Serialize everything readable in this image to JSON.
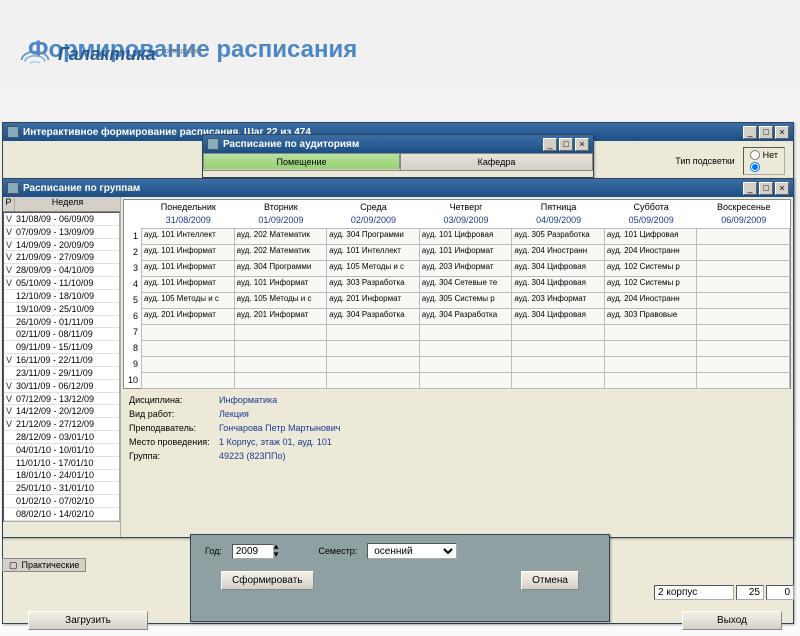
{
  "brand": {
    "name": "Галактика",
    "tag": "корпорация"
  },
  "page_title": "Формирование расписания",
  "win_main": {
    "title": "Интерактивное формирование расписания. Шаг 22 из 474",
    "highlight_label": "Тип подсветки",
    "radio_no": "Нет"
  },
  "win_rooms": {
    "title": "Расписание по аудиториям",
    "tabs": [
      "Помещение",
      "Кафедра"
    ]
  },
  "win_groups": {
    "title": "Расписание по группам",
    "week_label": "Неделя",
    "row_hdr": "Р",
    "weeks": [
      "31/08/09 - 06/09/09",
      "07/09/09 - 13/09/09",
      "14/09/09 - 20/09/09",
      "21/09/09 - 27/09/09",
      "28/09/09 - 04/10/09",
      "05/10/09 - 11/10/09",
      "12/10/09 - 18/10/09",
      "19/10/09 - 25/10/09",
      "26/10/09 - 01/11/09",
      "02/11/09 - 08/11/09",
      "09/11/09 - 15/11/09",
      "16/11/09 - 22/11/09",
      "23/11/09 - 29/11/09",
      "30/11/09 - 06/12/09",
      "07/12/09 - 13/12/09",
      "14/12/09 - 20/12/09",
      "21/12/09 - 27/12/09",
      "28/12/09 - 03/01/10",
      "04/01/10 - 10/01/10",
      "11/01/10 - 17/01/10",
      "18/01/10 - 24/01/10",
      "25/01/10 - 31/01/10",
      "01/02/10 - 07/02/10",
      "08/02/10 - 14/02/10"
    ],
    "checked": [
      0,
      1,
      2,
      3,
      4,
      5,
      11,
      13,
      14,
      15,
      16
    ],
    "days": [
      "Понедельник",
      "Вторник",
      "Среда",
      "Четверг",
      "Пятница",
      "Суббота",
      "Воскресенье"
    ],
    "dates": [
      "31/08/2009",
      "01/09/2009",
      "02/09/2009",
      "03/09/2009",
      "04/09/2009",
      "05/09/2009",
      "06/09/2009"
    ],
    "rows": [
      [
        "ауд. 101 Интеллект",
        "ауд. 202 Математик",
        "ауд. 304 Программи",
        "ауд. 101 Цифровая",
        "ауд. 305 Разработка",
        "ауд. 101 Цифровая",
        ""
      ],
      [
        "ауд. 101 Информат",
        "ауд. 202 Математик",
        "ауд. 101 Интеллект",
        "ауд. 101 Информат",
        "ауд. 204 Иностранн",
        "ауд. 204 Иностранн",
        ""
      ],
      [
        "ауд. 101 Информат",
        "ауд. 304 Программи",
        "ауд. 105 Методы и с",
        "ауд. 203 Информат",
        "ауд. 304 Цифровая",
        "ауд. 102 Системы р",
        ""
      ],
      [
        "ауд. 101 Информат",
        "ауд. 101 Информат",
        "ауд. 303 Разработка",
        "ауд. 304 Сетевые те",
        "ауд. 304 Цифровая",
        "ауд. 102 Системы р",
        ""
      ],
      [
        "ауд. 105 Методы и с",
        "ауд. 105 Методы и с",
        "ауд. 201 Информат",
        "ауд. 305 Системы р",
        "ауд. 203 Информат",
        "ауд. 204 Иностранн",
        ""
      ],
      [
        "ауд. 201 Информат",
        "ауд. 201 Информат",
        "ауд. 304 Разработка",
        "ауд. 304 Разработка",
        "ауд. 304 Цифровая",
        "ауд. 303 Правовые",
        ""
      ],
      [
        "",
        "",
        "",
        "",
        "",
        "",
        ""
      ],
      [
        "",
        "",
        "",
        "",
        "",
        "",
        ""
      ],
      [
        "",
        "",
        "",
        "",
        "",
        "",
        ""
      ],
      [
        "",
        "",
        "",
        "",
        "",
        "",
        ""
      ]
    ],
    "info": {
      "discipline_lbl": "Дисциплина:",
      "discipline": "Информатика",
      "work_lbl": "Вид работ:",
      "work": "Лекция",
      "teacher_lbl": "Преподаватель:",
      "teacher": "Гончарова Петр Мартынович",
      "place_lbl": "Место проведения:",
      "place": "1 Корпус, этаж 01, ауд. 101",
      "group_lbl": "Группа:",
      "group": "49223 (823ППо)"
    }
  },
  "bottom": {
    "practical_tab": "Практические",
    "load_btn": "Загрузить",
    "exit_btn": "Выход",
    "building_label": "2 корпус",
    "num1": "25",
    "num2": "0"
  },
  "dlg": {
    "year_lbl": "Год:",
    "year": "2009",
    "sem_lbl": "Семестр:",
    "sem": "осенний",
    "form_btn": "Сформировать",
    "cancel_btn": "Отмена"
  }
}
